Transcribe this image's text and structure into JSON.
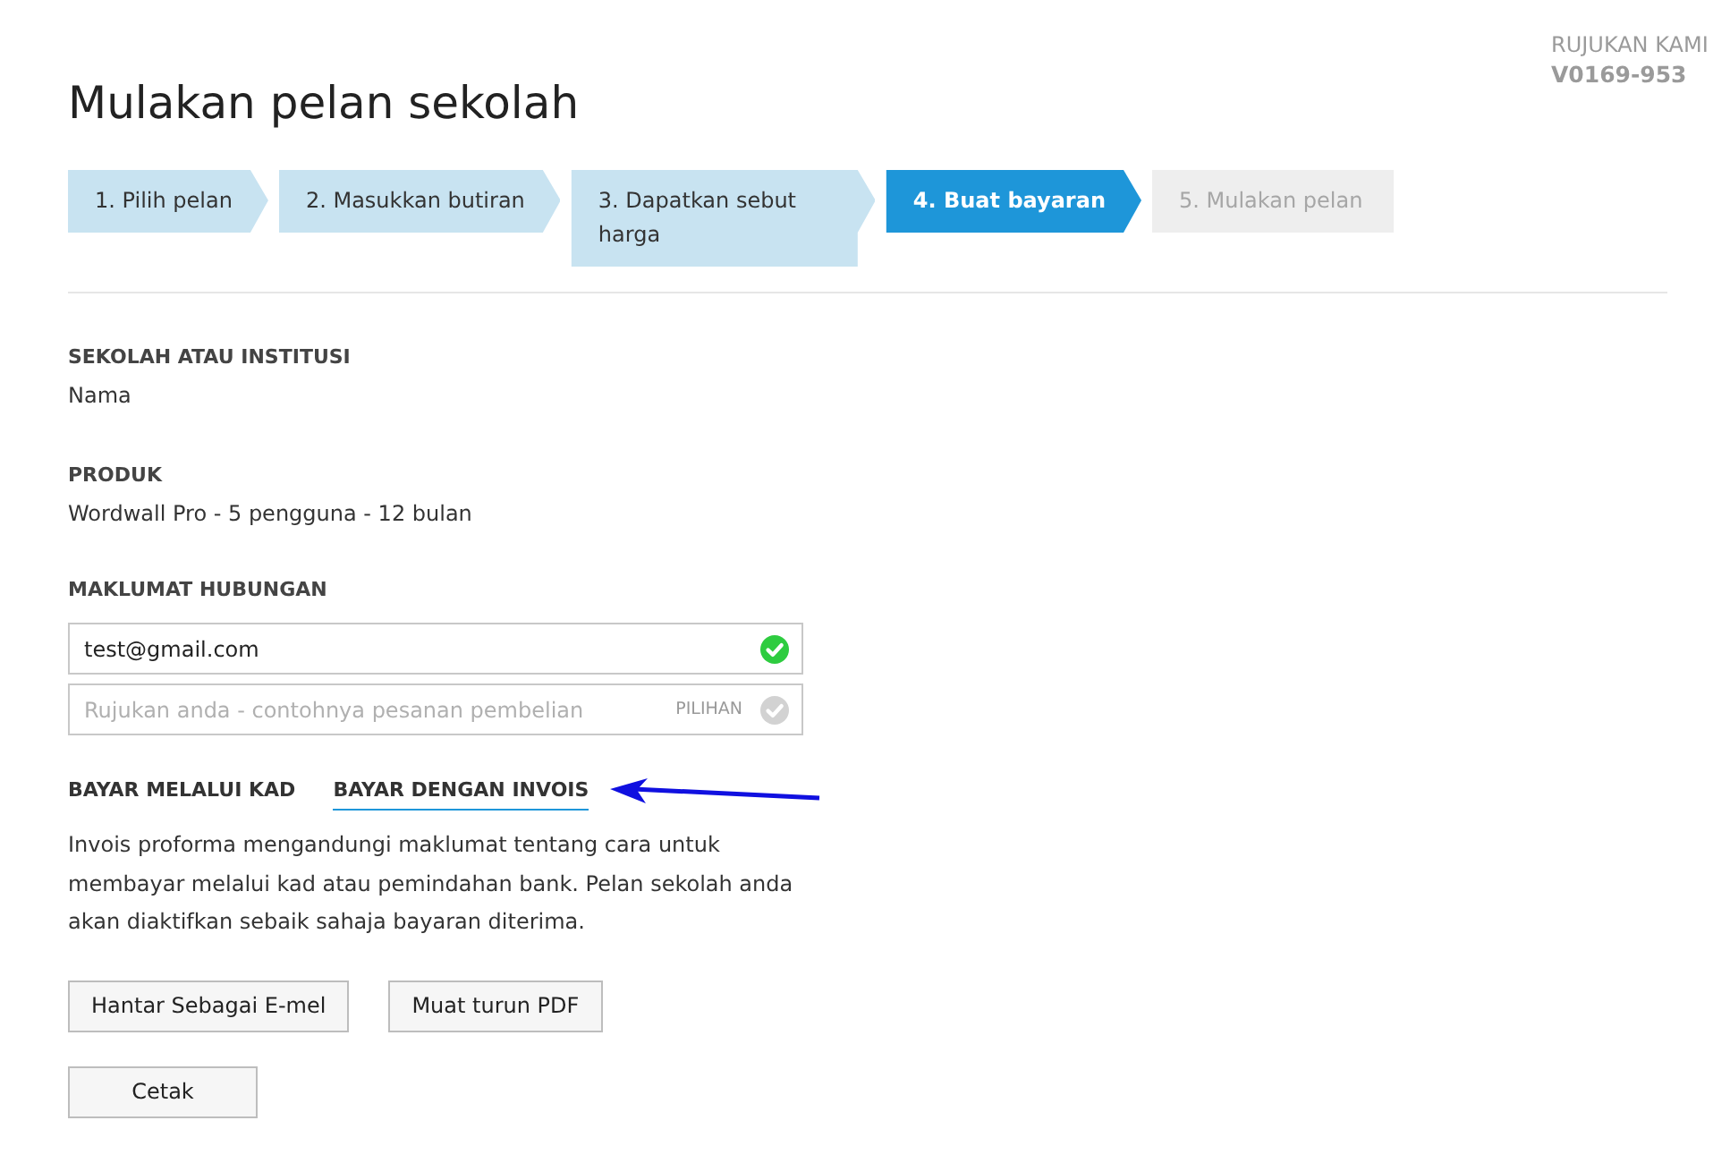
{
  "reference": {
    "label": "RUJUKAN KAMI",
    "value": "V0169-953"
  },
  "title": "Mulakan pelan sekolah",
  "steps": [
    {
      "label": "1. Pilih pelan",
      "completed": true,
      "selected": false
    },
    {
      "label": "2. Masukkan butiran",
      "completed": true,
      "selected": false
    },
    {
      "label": "3. Dapatkan sebut harga",
      "completed": true,
      "selected": false
    },
    {
      "label": "4. Buat bayaran",
      "completed": false,
      "selected": true
    },
    {
      "label": "5. Mulakan pelan",
      "completed": false,
      "selected": false
    }
  ],
  "sections": [
    {
      "heading": "SEKOLAH ATAU INSTITUSI",
      "value": "Nama"
    },
    {
      "heading": "PRODUK",
      "value": "Wordwall Pro - 5 pengguna - 12 bulan"
    }
  ],
  "contact": {
    "heading": "MAKLUMAT HUBUNGAN",
    "fields": [
      {
        "value": "test@gmail.com",
        "valid": true
      },
      {
        "placeholder": "Rujukan anda - contohnya pesanan pembelian",
        "tag": "PILIHAN",
        "valid": false
      }
    ]
  },
  "payment_tabs": [
    {
      "label": "BAYAR MELALUI KAD",
      "selected": false
    },
    {
      "label": "BAYAR DENGAN INVOIS",
      "selected": true
    }
  ],
  "description": "Invois proforma mengandungi maklumat tentang cara untuk membayar melalui kad atau pemindahan bank. Pelan sekolah anda akan diaktifkan sebaik sahaja bayaran diterima.",
  "buttons": [
    "Hantar Sebagai E-mel",
    "Muat turun PDF",
    "Cetak"
  ]
}
